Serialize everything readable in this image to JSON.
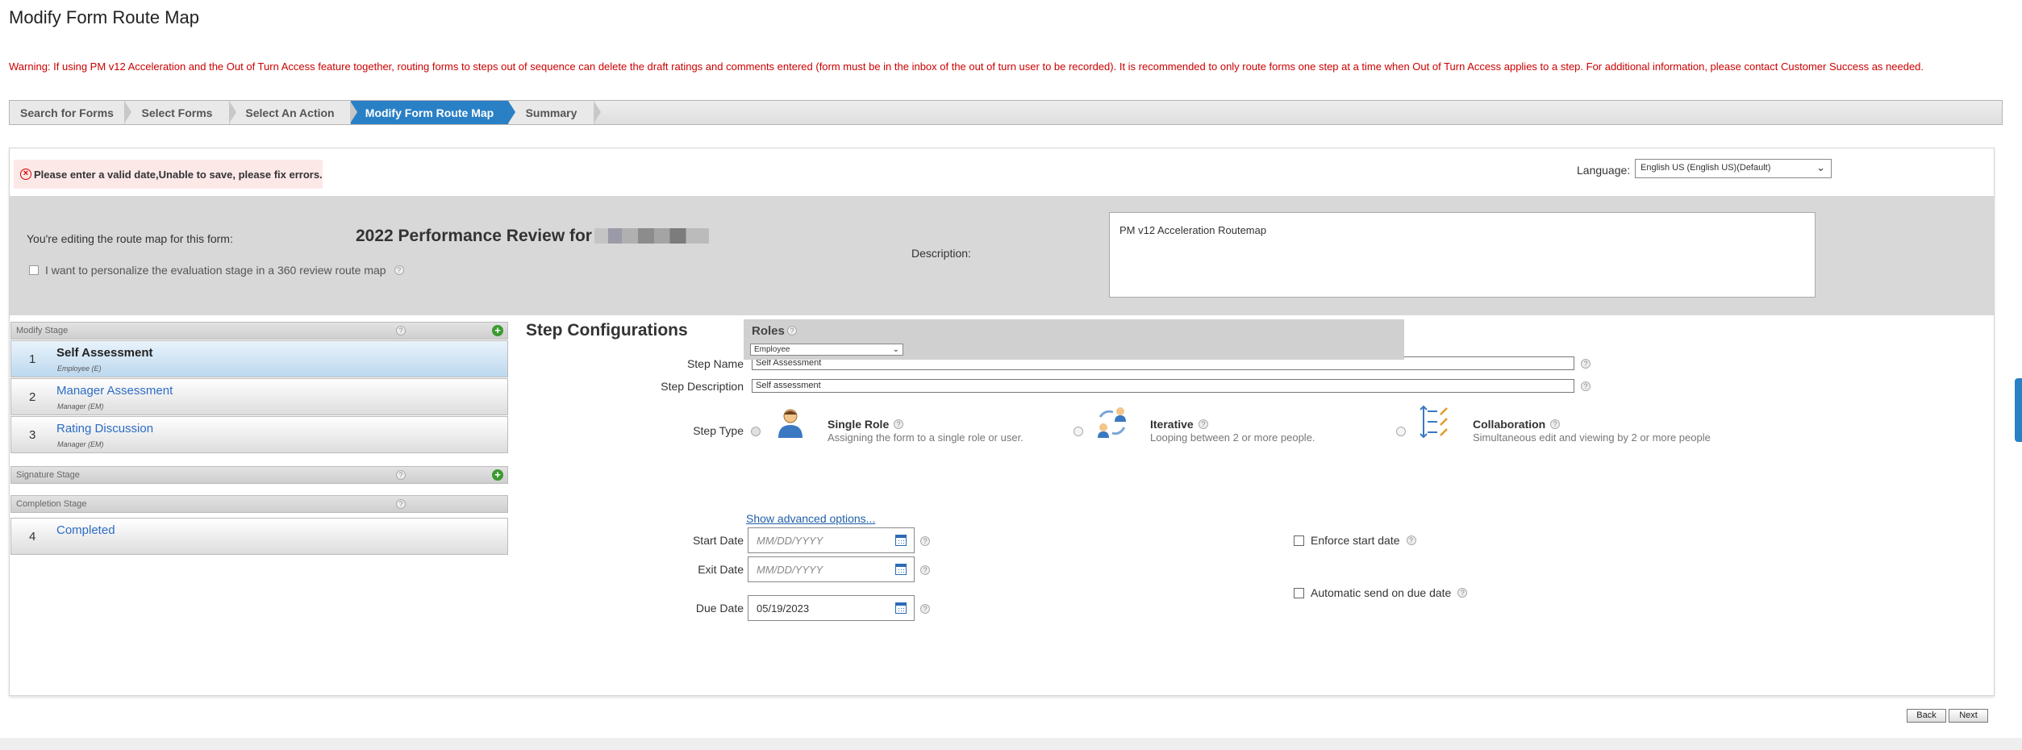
{
  "page": {
    "title": "Modify Form Route Map",
    "warning": "Warning: If using PM v12 Acceleration and the Out of Turn Access feature together, routing forms to steps out of sequence can delete the draft ratings and comments entered (form must be in the inbox of the out of turn user to be recorded). It is recommended to only route forms one step at a time when Out of Turn Access applies to a step. For additional information, please contact Customer Success as needed."
  },
  "wizard": {
    "steps": [
      {
        "label": "Search for Forms",
        "active": false
      },
      {
        "label": "Select Forms",
        "active": false
      },
      {
        "label": "Select An Action",
        "active": false
      },
      {
        "label": "Modify Form Route Map",
        "active": true
      },
      {
        "label": "Summary",
        "active": false
      }
    ]
  },
  "panel": {
    "error": "Please enter a valid date,Unable to save, please fix errors.",
    "error_icon": "error-circle-x-icon",
    "language_label": "Language:",
    "language_value": "English US (English US)(Default)",
    "editing_label": "You're editing the route map for this form:",
    "form_title": "2022 Performance Review for",
    "personalize_label": "I want to personalize the evaluation stage in a 360 review route map",
    "description_label": "Description:",
    "description_value": "PM v12 Acceleration Routemap"
  },
  "stages": {
    "modify_header": "Modify Stage",
    "signature_header": "Signature Stage",
    "completion_header": "Completion Stage",
    "modify_items": [
      {
        "num": "1",
        "name": "Self Assessment",
        "role": "Employee (E)",
        "selected": true
      },
      {
        "num": "2",
        "name": "Manager Assessment",
        "role": "Manager (EM)",
        "selected": false
      },
      {
        "num": "3",
        "name": "Rating Discussion",
        "role": "Manager (EM)",
        "selected": false
      }
    ],
    "completion_items": [
      {
        "num": "4",
        "name": "Completed",
        "role": "",
        "selected": false
      }
    ]
  },
  "step_config": {
    "title": "Step Configurations",
    "step_name_label": "Step Name",
    "step_name_value": "Self Assessment",
    "step_desc_label": "Step Description",
    "step_desc_value": "Self assessment",
    "step_type_label": "Step Type",
    "types": [
      {
        "title": "Single Role",
        "sub": "Assigning the form to a single role or user.",
        "icon": "single-role-icon"
      },
      {
        "title": "Iterative",
        "sub": "Looping between 2 or more people.",
        "icon": "iterative-icon"
      },
      {
        "title": "Collaboration",
        "sub": "Simultaneous edit and viewing by 2 or more people",
        "icon": "collaboration-icon"
      }
    ],
    "roles_title": "Roles",
    "roles_value": "Employee",
    "start_date_label": "Start Date",
    "start_date_placeholder": "MM/DD/YYYY",
    "exit_date_label": "Exit Date",
    "exit_date_placeholder": "MM/DD/YYYY",
    "due_date_label": "Due Date",
    "due_date_value": "05/19/2023",
    "enforce_label": "Enforce start date",
    "auto_send_label": "Automatic send on due date",
    "advanced_link": "Show advanced options..."
  },
  "footer": {
    "back_label": "Back",
    "next_label": "Next"
  }
}
